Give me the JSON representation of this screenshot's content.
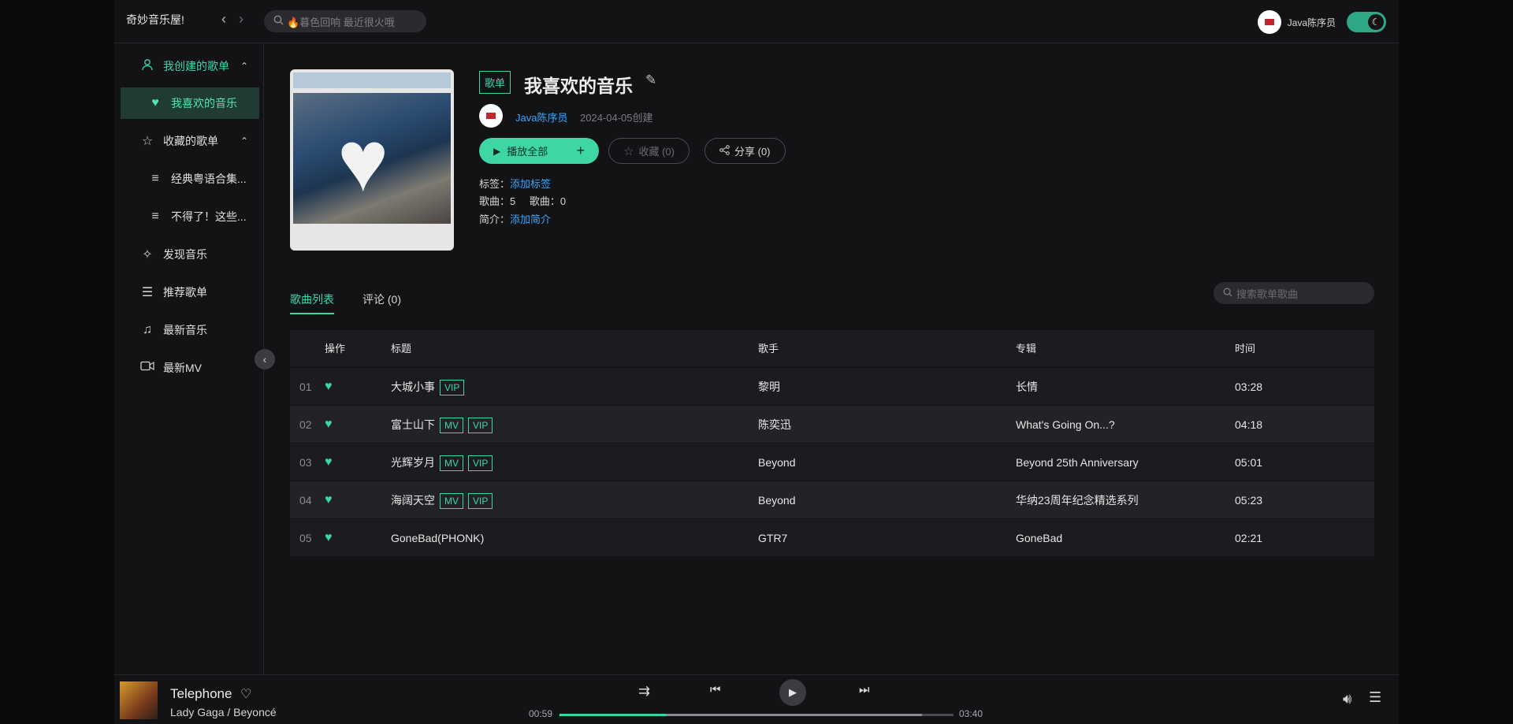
{
  "app": {
    "title": "奇妙音乐屋!"
  },
  "search": {
    "placeholder": "🔥暮色回响 最近很火哦"
  },
  "user": {
    "name": "Java陈序员"
  },
  "sidebar": {
    "items": [
      {
        "label": "我创建的歌单",
        "icon": "user-icon",
        "expanded": true
      },
      {
        "label": "我喜欢的音乐",
        "icon": "heart-icon",
        "active": true
      },
      {
        "label": "收藏的歌单",
        "icon": "star-icon",
        "expanded": true
      },
      {
        "label": "经典粤语合集...",
        "icon": "playlist-icon"
      },
      {
        "label": "不得了！这些...",
        "icon": "playlist-icon"
      },
      {
        "label": "发现音乐",
        "icon": "sparkle-icon"
      },
      {
        "label": "推荐歌单",
        "icon": "list-icon"
      },
      {
        "label": "最新音乐",
        "icon": "music-note-icon"
      },
      {
        "label": "最新MV",
        "icon": "video-icon"
      }
    ]
  },
  "playlist": {
    "type_badge": "歌单",
    "title": "我喜欢的音乐",
    "creator": "Java陈序员",
    "created": "2024-04-05创建",
    "play_all": "播放全部",
    "favorite": "收藏 (0)",
    "share": "分享 (0)",
    "tags_label": "标签：",
    "tags_link": "添加标签",
    "songs_label": "歌曲：",
    "songs_count": "5",
    "songs_label2": "歌曲：",
    "songs_count2": "0",
    "intro_label": "简介：",
    "intro_link": "添加简介"
  },
  "tabs": [
    {
      "label": "歌曲列表",
      "active": true
    },
    {
      "label": "评论 (0)",
      "active": false
    }
  ],
  "song_search": {
    "placeholder": "搜索歌单歌曲"
  },
  "table": {
    "headers": {
      "op": "操作",
      "title": "标题",
      "singer": "歌手",
      "album": "专辑",
      "time": "时间"
    },
    "rows": [
      {
        "idx": "01",
        "title": "大城小事",
        "mv": "",
        "vip": "VIP",
        "singer": "黎明",
        "album": "长情",
        "time": "03:28"
      },
      {
        "idx": "02",
        "title": "富士山下",
        "mv": "MV",
        "vip": "VIP",
        "singer": "陈奕迅",
        "album": "What's Going On...?",
        "time": "04:18"
      },
      {
        "idx": "03",
        "title": "光辉岁月",
        "mv": "MV",
        "vip": "VIP",
        "singer": "Beyond",
        "album": "Beyond 25th Anniversary",
        "time": "05:01"
      },
      {
        "idx": "04",
        "title": "海阔天空",
        "mv": "MV",
        "vip": "VIP",
        "singer": "Beyond",
        "album": "华纳23周年纪念精选系列",
        "time": "05:23"
      },
      {
        "idx": "05",
        "title": "GoneBad(PHONK)",
        "mv": "",
        "vip": "",
        "singer": "GTR7",
        "album": "GoneBad",
        "time": "02:21"
      }
    ]
  },
  "player": {
    "title": "Telephone",
    "artist": "Lady Gaga / Beyoncé",
    "current": "00:59",
    "duration": "03:40",
    "progress": 0.27,
    "buffered": 0.92
  },
  "colors": {
    "accent": "#3fd6a6",
    "link": "#3aa6ff",
    "background": "#131316"
  }
}
